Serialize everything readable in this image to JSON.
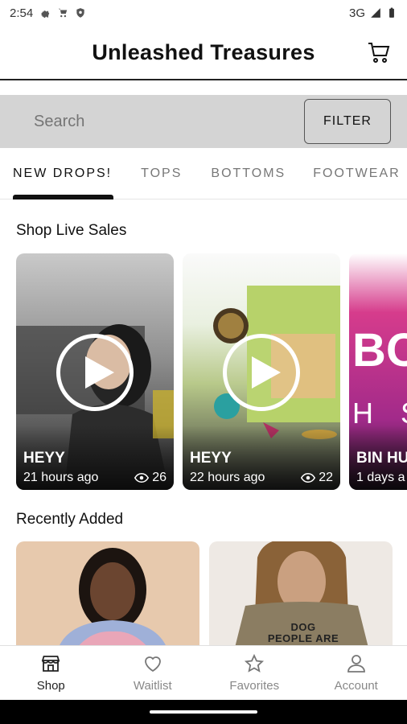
{
  "status_bar": {
    "time": "2:54",
    "network": "3G"
  },
  "header": {
    "title": "Unleashed Treasures"
  },
  "search": {
    "placeholder": "Search",
    "filter_label": "FILTER"
  },
  "tabs": [
    {
      "label": "NEW DROPS!",
      "active": true
    },
    {
      "label": "TOPS",
      "active": false
    },
    {
      "label": "BOTTOMS",
      "active": false
    },
    {
      "label": "FOOTWEAR",
      "active": false
    }
  ],
  "sections": {
    "live": "Shop Live Sales",
    "recent": "Recently Added"
  },
  "live_sales": [
    {
      "name": "HEYY",
      "time": "21 hours ago",
      "views": "26"
    },
    {
      "name": "HEYY",
      "time": "22 hours ago",
      "views": "22"
    },
    {
      "name": "BIN HU",
      "time": "1 days a",
      "views": ""
    }
  ],
  "live_card_3_art": {
    "big": "BO",
    "sub": "H S"
  },
  "recent_items": [
    {
      "caption": ""
    },
    {
      "caption": "DOG PEOPLE ARE MY"
    }
  ],
  "nav": [
    {
      "label": "Shop",
      "icon": "shop-icon",
      "active": true
    },
    {
      "label": "Waitlist",
      "icon": "heart-icon",
      "active": false
    },
    {
      "label": "Favorites",
      "icon": "star-icon",
      "active": false
    },
    {
      "label": "Account",
      "icon": "account-icon",
      "active": false
    }
  ],
  "colors": {
    "accent": "#111111",
    "tab_inactive": "#777777",
    "search_bg": "#d4d4d4"
  }
}
